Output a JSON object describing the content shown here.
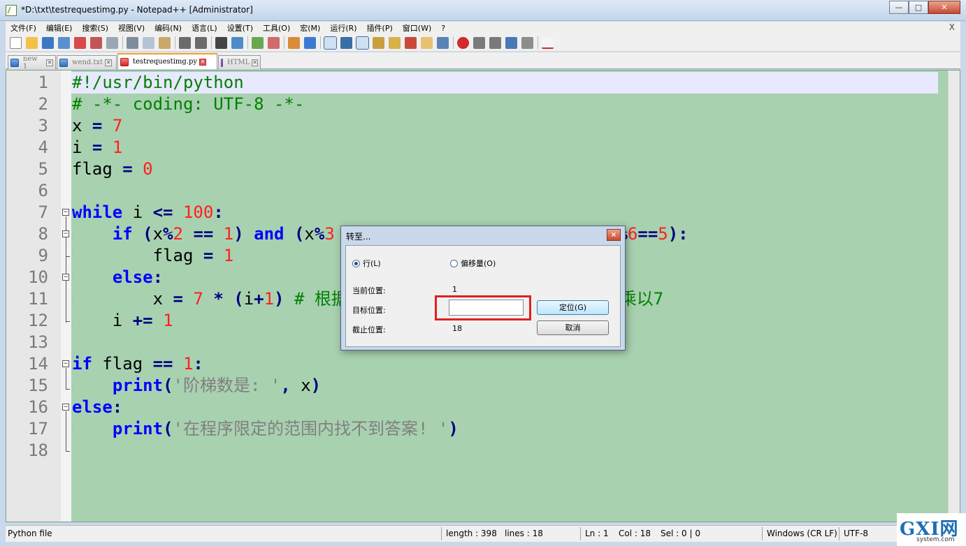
{
  "window": {
    "title": "*D:\\txt\\testrequestimg.py - Notepad++ [Administrator]"
  },
  "menu": [
    "文件(F)",
    "编辑(E)",
    "搜索(S)",
    "视图(V)",
    "编码(N)",
    "语言(L)",
    "设置(T)",
    "工具(O)",
    "宏(M)",
    "运行(R)",
    "插件(P)",
    "窗口(W)",
    "?"
  ],
  "menu_close": "X",
  "tabs": [
    {
      "label": "new 1",
      "icon": "file-saved-icon",
      "active": false
    },
    {
      "label": "wend.txt",
      "icon": "file-saved-icon",
      "active": false
    },
    {
      "label": "testrequestimg.py",
      "icon": "file-unsaved-icon",
      "active": true
    },
    {
      "label": "HTML",
      "icon": "file-html-icon",
      "active": false
    }
  ],
  "editor": {
    "line_numbers": [
      "1",
      "2",
      "3",
      "4",
      "5",
      "6",
      "7",
      "8",
      "9",
      "10",
      "11",
      "12",
      "13",
      "14",
      "15",
      "16",
      "17",
      "18"
    ],
    "current_line": 1
  },
  "dialog": {
    "title": "转至...",
    "radio_line": "行(L)",
    "radio_offset": "偏移量(O)",
    "current_label": "当前位置:",
    "current_value": "1",
    "target_label": "目标位置:",
    "target_value": "",
    "end_label": "截止位置:",
    "end_value": "18",
    "go_button": "定位(G)",
    "cancel_button": "取消",
    "close": "×"
  },
  "status": {
    "file_type": "Python file",
    "length": "length : 398",
    "lines": "lines : 18",
    "ln": "Ln : 1",
    "col": "Col : 18",
    "sel": "Sel : 0 | 0",
    "eol": "Windows (CR LF)",
    "encoding": "UTF-8"
  },
  "watermark": {
    "main": "GXI网",
    "sub": "system.com"
  }
}
